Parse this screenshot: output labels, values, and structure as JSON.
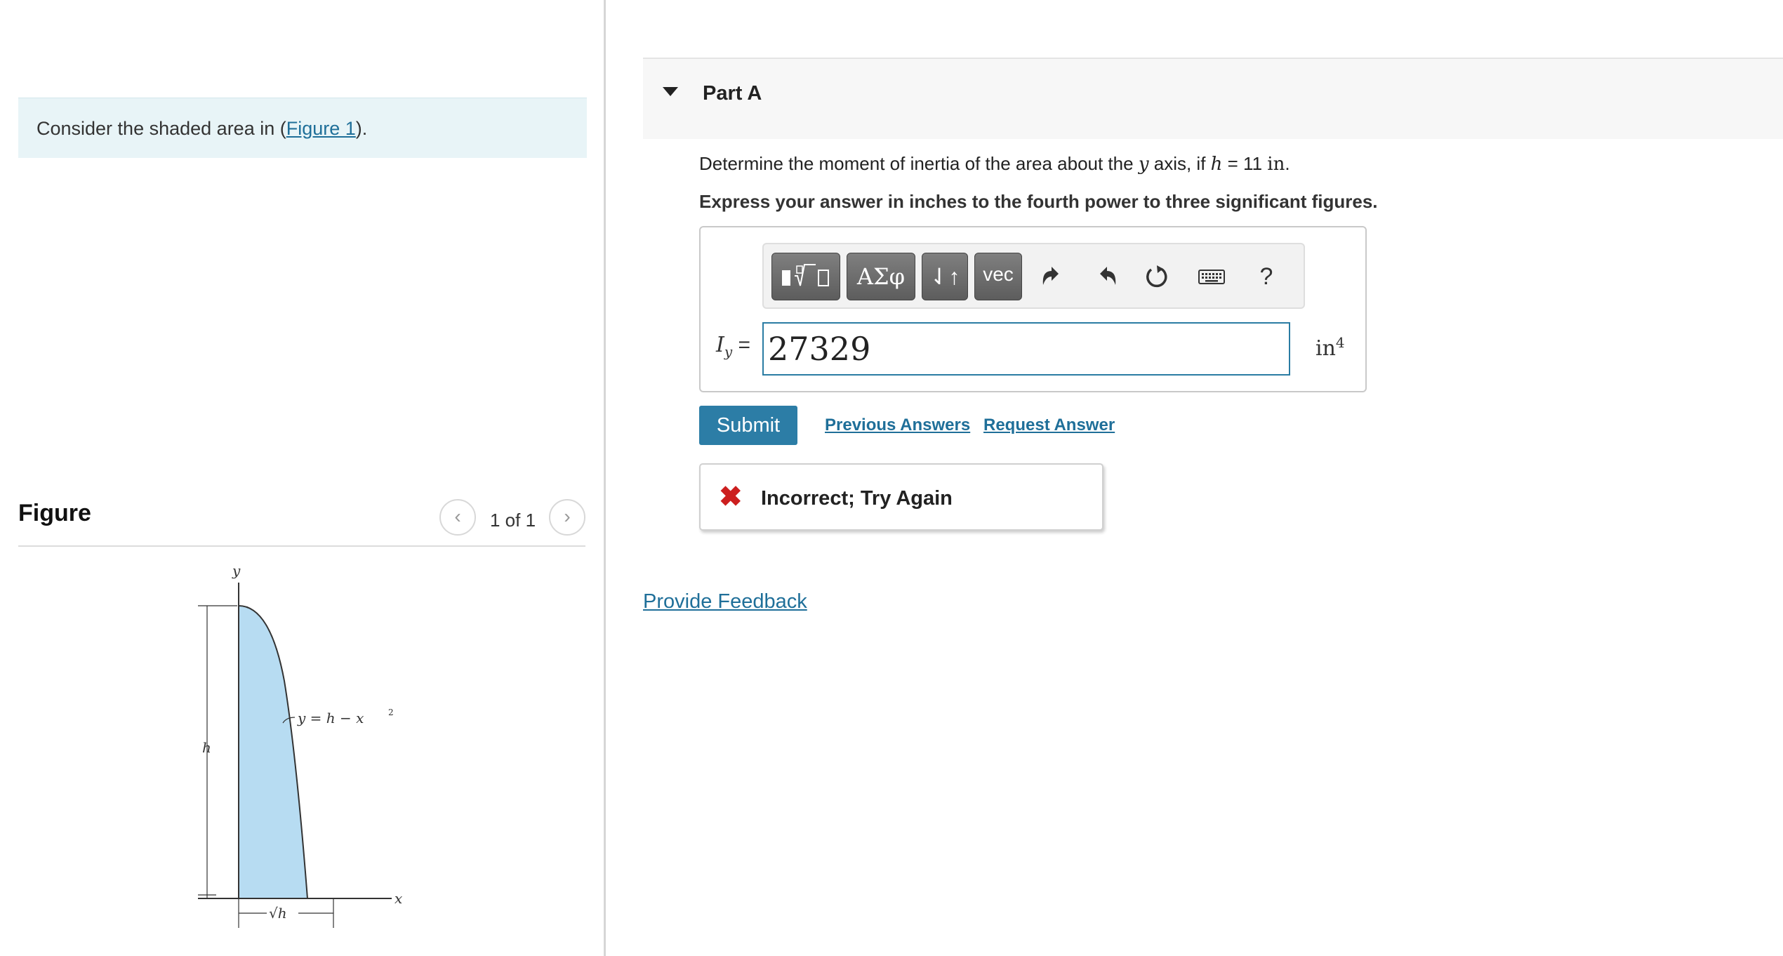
{
  "problem": {
    "prefix": "Consider the shaded area in (",
    "link": "Figure 1",
    "suffix": ")."
  },
  "figure": {
    "title": "Figure",
    "counter": "1 of 1",
    "prev_icon": "chevron-left-icon",
    "next_icon": "chevron-right-icon",
    "labels": {
      "y_axis": "y",
      "x_axis": "x",
      "height": "h",
      "curve": "y = h − x",
      "curve_exp": "2",
      "base": "√h"
    },
    "fill_color": "#b7dcf2"
  },
  "part": {
    "title": "Part A",
    "caret_icon": "caret-down-icon"
  },
  "question": {
    "prefix": "Determine the moment of inertia of the area about the ",
    "axis": "y",
    "middle": " axis, if ",
    "var": "h",
    "equals": " = 11 ",
    "unit": "in",
    "suffix": "."
  },
  "instruction": "Express your answer in inches to the fourth power to three significant figures.",
  "toolbar": {
    "templates_icon": "math-templates-icon",
    "greek_label": "ΑΣφ",
    "arrows_label": "⇃↑",
    "vec_label": "vec",
    "undo_icon": "undo-icon",
    "redo_icon": "redo-icon",
    "reset_icon": "reset-icon",
    "keyboard_icon": "keyboard-icon",
    "help_label": "?"
  },
  "answer": {
    "var_symbol": "I",
    "var_subscript": "y",
    "equals": " =",
    "value": "27329",
    "unit": "in",
    "unit_exp": "4"
  },
  "actions": {
    "submit": "Submit",
    "previous_answers": "Previous Answers",
    "request_answer": "Request Answer"
  },
  "feedback": {
    "icon": "x-mark-icon",
    "text": "Incorrect; Try Again"
  },
  "provide_feedback": "Provide Feedback",
  "colors": {
    "accent": "#2c7da6",
    "link": "#1f6f99",
    "error": "#cc1f1f",
    "problem_bg": "#e8f4f7"
  }
}
